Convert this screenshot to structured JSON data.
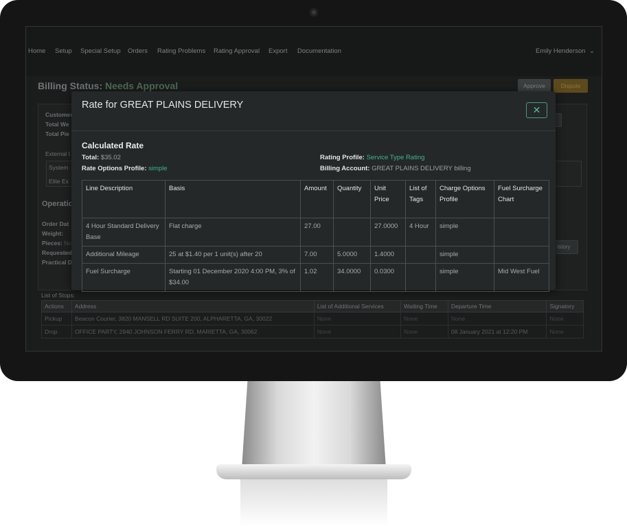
{
  "nav": {
    "items": [
      "Home",
      "Setup",
      "Special Setup",
      "Orders",
      "Rating Problems",
      "Rating Approval",
      "Export",
      "Documentation"
    ],
    "user": "Emily Henderson"
  },
  "page": {
    "title_prefix": "Billing Status:",
    "status": "Needs Approval",
    "approve_label": "Approve",
    "dispute_label": "Dispute"
  },
  "background": {
    "customer_label": "Customer",
    "total_weight_label": "Total We",
    "total_pieces_label": "Total Pie",
    "external_label": "External I",
    "system_label": "System",
    "elite_label": "Elite Ex",
    "operations_heading": "Operatio",
    "order_date_label": "Order Dat",
    "weight_label": "Weight:",
    "pieces_label": "Pieces:",
    "pieces_value": "No",
    "requested_label": "Requested",
    "practical_label": "Practical D",
    "history_button": "istory"
  },
  "stops": {
    "title": "List of Stops:",
    "headers": [
      "Actions",
      "Address",
      "List of Additional Services",
      "Waiting Time",
      "Departure Time",
      "Signatory"
    ],
    "rows": [
      [
        "Pickup",
        "Beacon Courier, 3820 MANSELL RD SUITE 200, ALPHARETTA, GA, 30022",
        "None",
        "None",
        "None",
        "None"
      ],
      [
        "Drop",
        "OFFICE PARTY, 2940 JOHNSON FERRY RD, MARIETTA, GA, 30062",
        "None",
        "None",
        "08 January 2021 at 12:20 PM",
        "None"
      ]
    ]
  },
  "modal": {
    "title": "Rate for GREAT PLAINS DELIVERY",
    "close_icon": "close-icon",
    "section_title": "Calculated Rate",
    "total_label": "Total:",
    "total_value": "$35.02",
    "rate_options_label": "Rate Options Profile:",
    "rate_options_value": "simple",
    "rating_profile_label": "Rating Profile:",
    "rating_profile_value": "Service Type Rating",
    "billing_account_label": "Billing Account:",
    "billing_account_value": "GREAT PLAINS DELIVERY billing",
    "table": {
      "headers": [
        "Line Description",
        "Basis",
        "Amount",
        "Quantity",
        "Unit Price",
        "List of Tags",
        "Charge Options Profile",
        "Fuel Surcharge Chart"
      ],
      "rows": [
        [
          "4 Hour Standard Delivery Base",
          "Flat charge",
          "27.00",
          "",
          "27.0000",
          "4 Hour",
          "simple",
          ""
        ],
        [
          "Additional Mileage",
          "25 at $1.40 per 1 unit(s) after 20",
          "7.00",
          "5.0000",
          "1.4000",
          "",
          "simple",
          ""
        ],
        [
          "Fuel Surcharge",
          "Starting 01 December 2020 4:00 PM, 3% of $34.00",
          "1.02",
          "34.0000",
          "0.0300",
          "",
          "simple",
          "Mid West Fuel"
        ]
      ]
    }
  },
  "colors": {
    "link": "#3fb58e",
    "modal_bg": "#252828",
    "screen_bg": "#1b1d1d"
  }
}
